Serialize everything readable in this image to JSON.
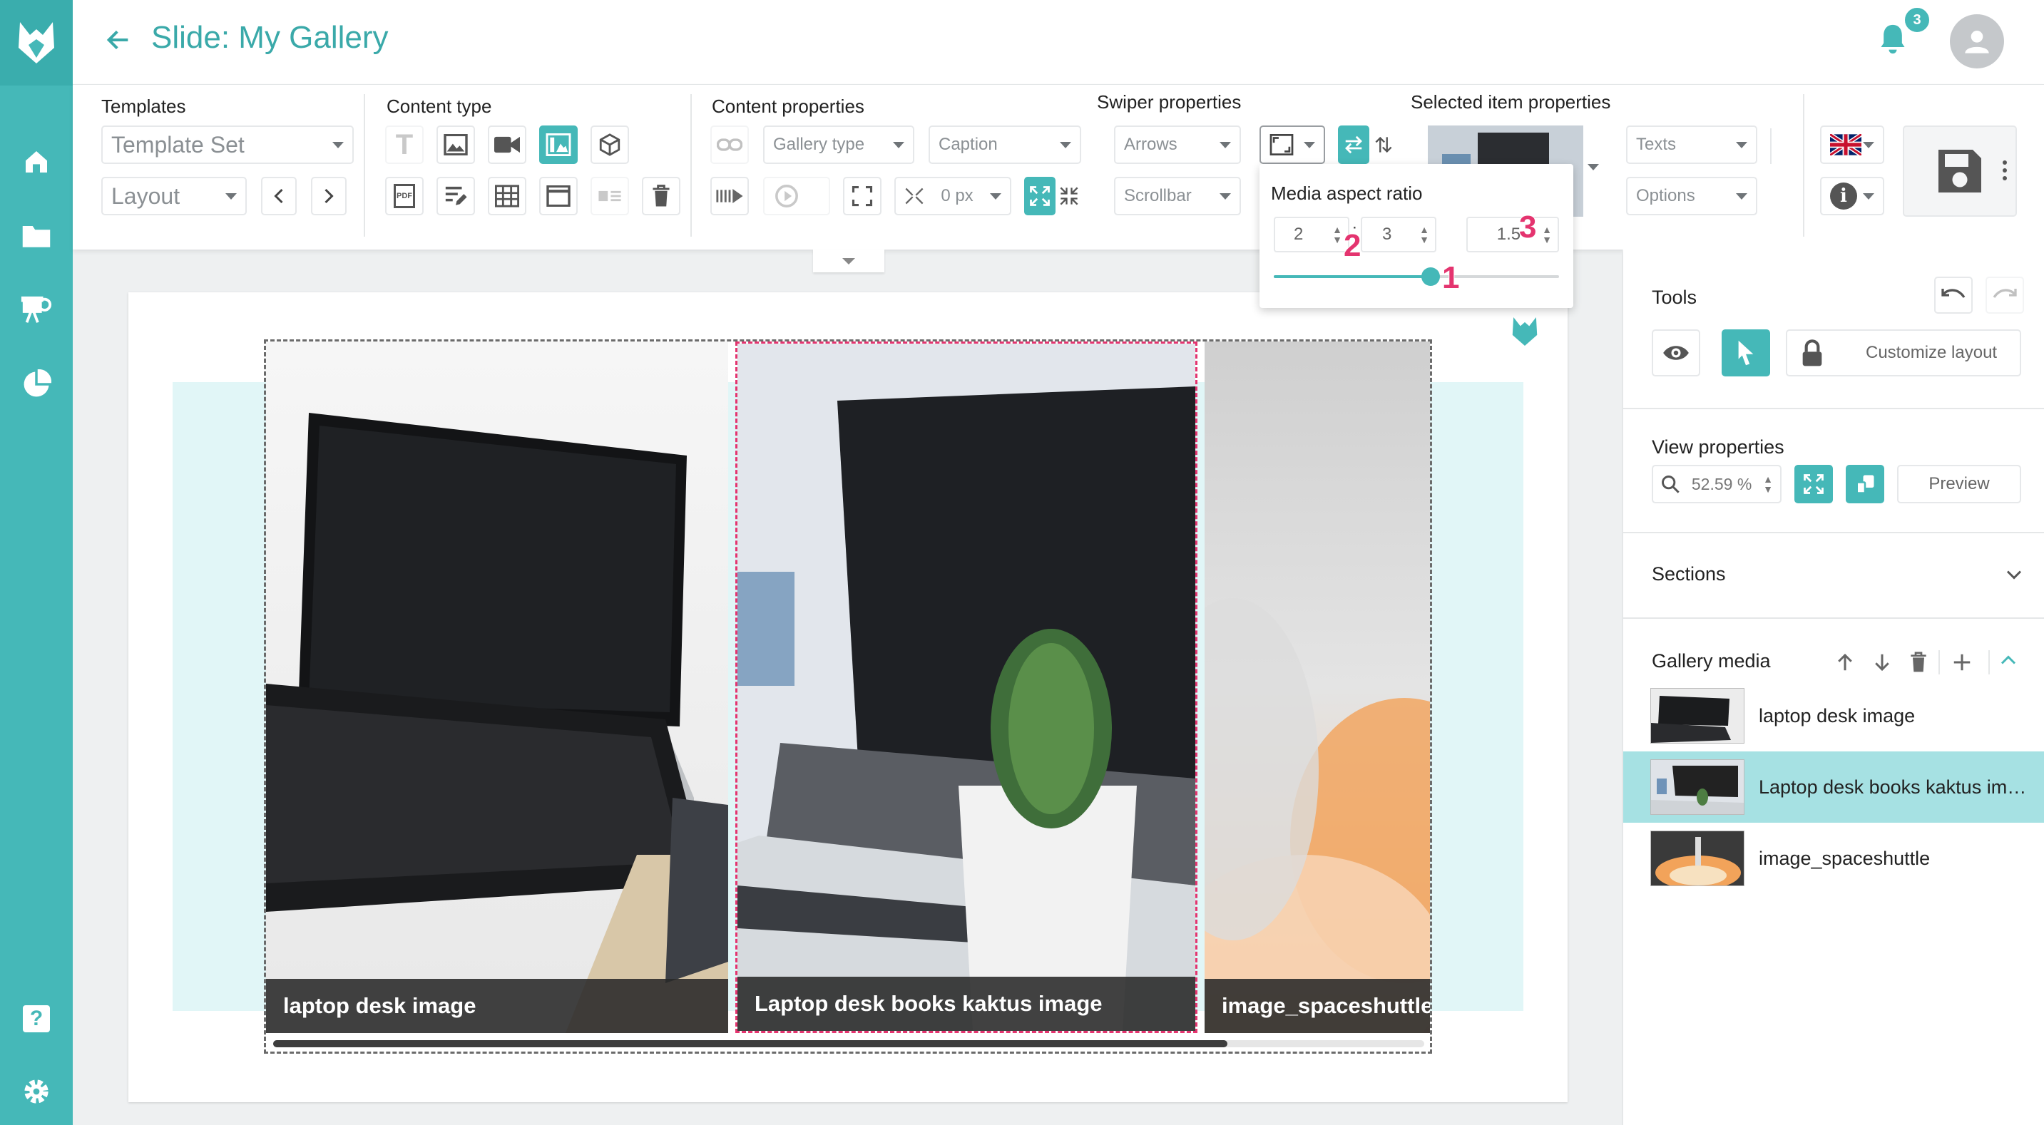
{
  "app": {
    "title": "Slide: My Gallery",
    "notification_count": "3"
  },
  "templates": {
    "label": "Templates",
    "template_set": "Template Set",
    "layout": "Layout"
  },
  "content_type": {
    "label": "Content type"
  },
  "content_properties": {
    "label": "Content properties",
    "gallery_type": "Gallery type",
    "caption": "Caption",
    "padding": "0 px"
  },
  "swiper_properties": {
    "label": "Swiper properties",
    "arrows": "Arrows",
    "scrollbar": "Scrollbar"
  },
  "media_aspect_ratio": {
    "label": "Media aspect ratio",
    "width": "2",
    "height": "3",
    "ratio": "1.5",
    "slider_level_percent": 55,
    "callouts": [
      "1",
      "2",
      "3"
    ]
  },
  "selected_item": {
    "label": "Selected item properties",
    "texts": "Texts",
    "options": "Options"
  },
  "gallery": {
    "items": [
      {
        "caption": "laptop desk image"
      },
      {
        "caption": "Laptop desk books kaktus image"
      },
      {
        "caption": "image_spaceshuttle"
      }
    ]
  },
  "tools": {
    "label": "Tools",
    "customize_layout": "Customize layout"
  },
  "view_properties": {
    "label": "View properties",
    "zoom": "52.59",
    "zoom_unit": "%",
    "preview": "Preview"
  },
  "sections": {
    "label": "Sections"
  },
  "gallery_media": {
    "label": "Gallery media",
    "items": [
      "laptop desk image",
      "Laptop desk books kaktus im…",
      "image_spaceshuttle"
    ]
  },
  "colors": {
    "accent": "#45b8b8",
    "selected_row": "#a6e1e3",
    "badge": "#e4346f",
    "selected_border": "#e4346f"
  }
}
